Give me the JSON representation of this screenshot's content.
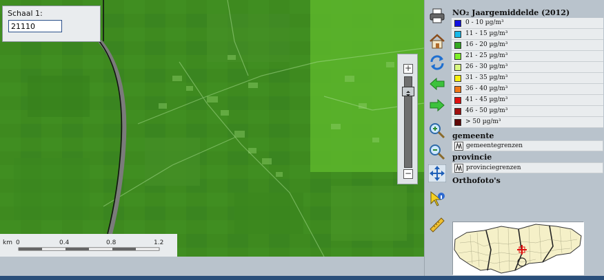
{
  "scale": {
    "label": "Schaal 1:",
    "value": "21110"
  },
  "scalebar": {
    "unit": "km",
    "ticks": [
      "0",
      "0.4",
      "0.8",
      "1.2"
    ]
  },
  "zoom": {
    "plus": "+",
    "minus": "−",
    "level": 0.08
  },
  "toolbar": {
    "tools": [
      "printer-icon",
      "home-icon",
      "refresh-icon",
      "back-arrow-icon",
      "forward-arrow-icon",
      "zoom-in-icon",
      "zoom-out-icon",
      "pan-icon",
      "identify-icon",
      "measure-icon"
    ]
  },
  "legend": {
    "title": "NO₂ Jaargemiddelde (2012)",
    "classes": [
      {
        "label": "0 - 10 µg/m³",
        "color": "#1010e0"
      },
      {
        "label": "11 - 15 µg/m³",
        "color": "#18b8e8"
      },
      {
        "label": "16 - 20 µg/m³",
        "color": "#34a822"
      },
      {
        "label": "21 - 25 µg/m³",
        "color": "#7ef02a"
      },
      {
        "label": "26 - 30 µg/m³",
        "color": "#d8f880"
      },
      {
        "label": "31 - 35 µg/m³",
        "color": "#f8f010"
      },
      {
        "label": "36 - 40 µg/m³",
        "color": "#f07818"
      },
      {
        "label": "41 - 45 µg/m³",
        "color": "#e01010"
      },
      {
        "label": "46 - 50 µg/m³",
        "color": "#a01010"
      },
      {
        "label": "> 50 µg/m³",
        "color": "#600808"
      }
    ],
    "groups": [
      {
        "name": "gemeente",
        "item": "gemeentegrenzen"
      },
      {
        "name": "provincie",
        "item": "provinciegrenzen"
      }
    ],
    "orthophoto": "Orthofoto's"
  }
}
